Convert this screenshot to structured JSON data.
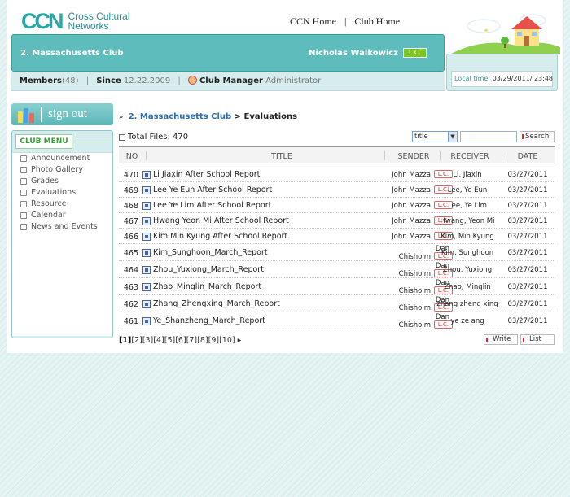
{
  "logo": {
    "mark": "CCN",
    "line1": "Cross Cultural",
    "line2": "Networks"
  },
  "topnav": {
    "home": "CCN Home",
    "sep": "|",
    "club": "Club Home"
  },
  "club": {
    "name": "2. Massachusetts Club",
    "user": "Nicholas Walkowicz",
    "user_badge": "L.C."
  },
  "info": {
    "members_label": "Members",
    "members_count": "(48)",
    "sep": "|",
    "since_label": "Since",
    "since_value": "12.22.2009",
    "manager_label": "Club Manager",
    "manager_value": "Administrator"
  },
  "local_time": {
    "label": "Local time",
    "value": ": 03/29/2011/ 23:48"
  },
  "signout": {
    "label": "sign out"
  },
  "club_menu": {
    "title": "CLUB MENU",
    "items": [
      "Announcement",
      "Photo Gallery",
      "Grades",
      "Evaluations",
      "Resource",
      "Calendar",
      "News and Events"
    ]
  },
  "breadcrumb": {
    "arrow": "»",
    "club": "2. Massachusetts Club",
    "sep": ">",
    "page": "Evaluations"
  },
  "files": {
    "label": "Total Files:",
    "count": "470"
  },
  "search": {
    "select_value": "title",
    "button": "Search"
  },
  "table": {
    "headers": {
      "no": "NO",
      "title": "TITLE",
      "sender": "SENDER",
      "receiver": "RECEIVER",
      "date": "DATE"
    },
    "lc_badge": "L.C.",
    "rows": [
      {
        "no": "470",
        "title": "Li Jiaxin After School Report",
        "sender": "John Mazza",
        "receiver": "Li, Jiaxin",
        "date": "03/27/2011"
      },
      {
        "no": "469",
        "title": "Lee Ye Eun After School Report",
        "sender": "John Mazza",
        "receiver": "Lee, Ye Eun",
        "date": "03/27/2011"
      },
      {
        "no": "468",
        "title": "Lee Ye Lim After School Report",
        "sender": "John Mazza",
        "receiver": "Lee, Ye Lim",
        "date": "03/27/2011"
      },
      {
        "no": "467",
        "title": "Hwang Yeon Mi After School Report",
        "sender": "John Mazza",
        "receiver": "Hwang, Yeon Mi",
        "date": "03/27/2011"
      },
      {
        "no": "466",
        "title": "Kim Min Kyung After School Report",
        "sender": "John Mazza",
        "receiver": "Kim, Min Kyung",
        "date": "03/27/2011"
      },
      {
        "no": "465",
        "title": "Kim_Sunghoon_March_Report",
        "sender_top": "Dan",
        "sender": "Chisholm",
        "receiver": "Kim, Sunghoon",
        "date": "03/27/2011"
      },
      {
        "no": "464",
        "title": "Zhou_Yuxiong_March_Report",
        "sender_top": "Dan",
        "sender": "Chisholm",
        "receiver": "Zhou, Yuxiong",
        "date": "03/27/2011"
      },
      {
        "no": "463",
        "title": "Zhao_Minglin_March_Report",
        "sender_top": "Dan",
        "sender": "Chisholm",
        "receiver": "Zhao, Minglin",
        "date": "03/27/2011"
      },
      {
        "no": "462",
        "title": "Zhang_Zhengxing_March_Report",
        "sender_top": "Dan",
        "sender": "Chisholm",
        "receiver": "zhang zheng xing",
        "date": "03/27/2011"
      },
      {
        "no": "461",
        "title": "Ye_Shanzheng_March_Report",
        "sender_top": "Dan",
        "sender": "Chisholm",
        "receiver": "ye ze ang",
        "date": "03/27/2011"
      }
    ]
  },
  "pager": {
    "pages": [
      "1",
      "2",
      "3",
      "4",
      "5",
      "6",
      "7",
      "8",
      "9",
      "10"
    ],
    "next": "▸"
  },
  "buttons": {
    "write": "Write",
    "list": "List"
  },
  "colors": {
    "teal": "#5fbcbc",
    "pale_teal": "#d7eded",
    "link_blue": "#2a6fb3",
    "lc_green": "#7cc61f",
    "lc_red": "#cc3333"
  }
}
